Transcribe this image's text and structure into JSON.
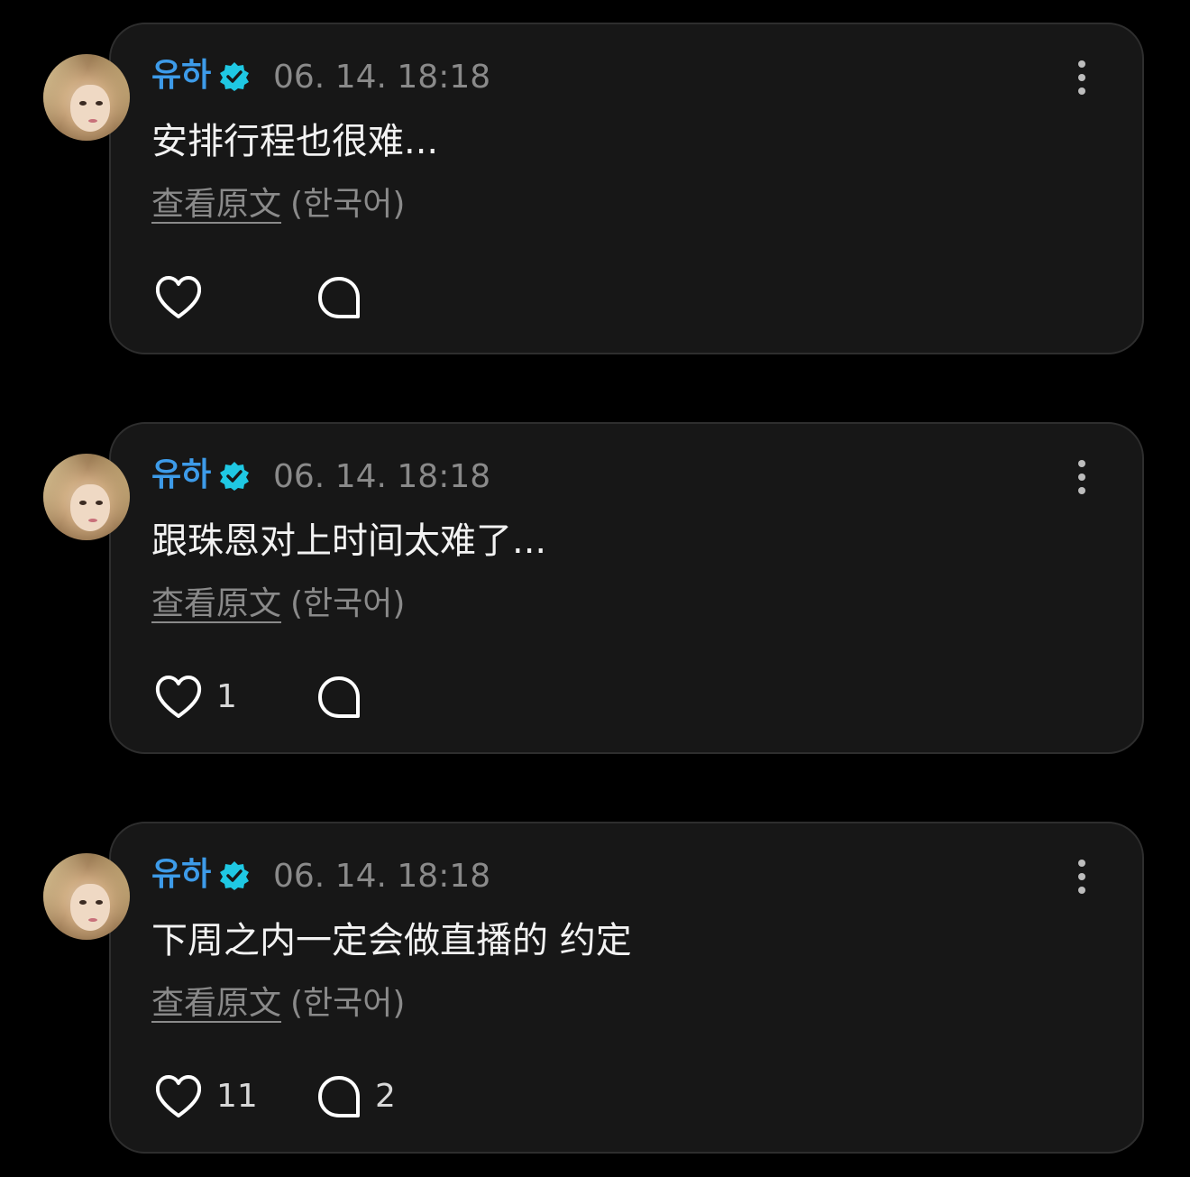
{
  "posts": [
    {
      "author": "유하",
      "timestamp": "06. 14. 18:18",
      "message": "安排行程也很难...",
      "translate_link": "查看原文",
      "translate_lang": "(한국어)",
      "likes": "",
      "replies": ""
    },
    {
      "author": "유하",
      "timestamp": "06. 14. 18:18",
      "message": "跟珠恩对上时间太难了...",
      "translate_link": "查看原文",
      "translate_lang": "(한국어)",
      "likes": "1",
      "replies": ""
    },
    {
      "author": "유하",
      "timestamp": "06. 14. 18:18",
      "message": "下周之内一定会做直播的 约定",
      "translate_link": "查看原文",
      "translate_lang": "(한국어)",
      "likes": "11",
      "replies": "2"
    }
  ],
  "colors": {
    "author": "#3d9be9",
    "verified": "#1fc8e3",
    "card_bg": "#171717",
    "muted_text": "#8a8a8a"
  },
  "icons": {
    "verified": "verified-badge-icon",
    "more": "more-vertical-icon",
    "like": "heart-icon",
    "reply": "comment-bubble-icon"
  }
}
